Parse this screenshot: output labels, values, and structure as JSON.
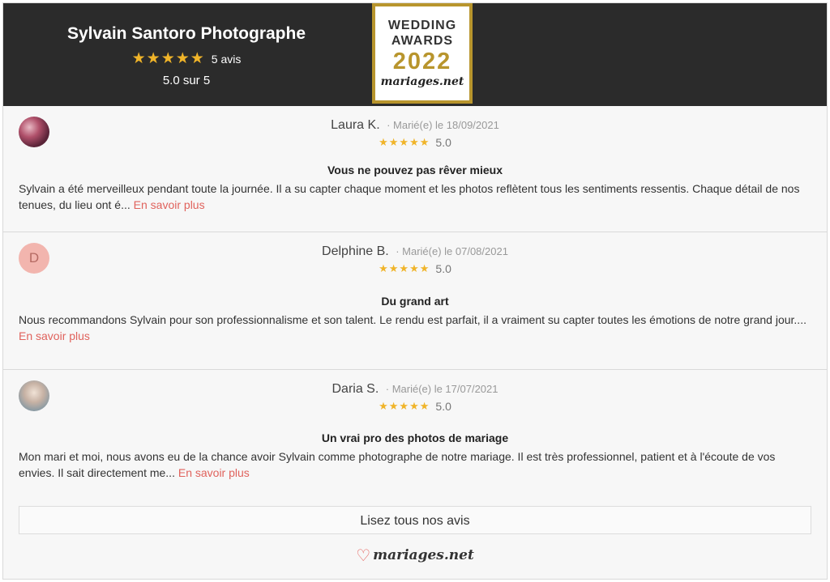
{
  "header": {
    "business_name": "Sylvain Santoro Photographe",
    "stars": "★★★★★",
    "review_count": "5 avis",
    "score": "5.0 sur 5"
  },
  "badge": {
    "line1": "WEDDING",
    "line2": "AWARDS",
    "year": "2022",
    "brand": "mariages.net"
  },
  "reviews": [
    {
      "name": "Laura K.",
      "date": "· Marié(e) le 18/09/2021",
      "stars": "★★★★★",
      "score": "5.0",
      "title": "Vous ne pouvez pas rêver mieux",
      "text": "Sylvain a été merveilleux pendant toute la journée. Il a su capter chaque moment et les photos reflètent tous les sentiments ressentis. Chaque détail de nos tenues, du lieu ont é...",
      "more": "En savoir plus"
    },
    {
      "name": "Delphine B.",
      "initial": "D",
      "date": "· Marié(e) le 07/08/2021",
      "stars": "★★★★★",
      "score": "5.0",
      "title": "Du grand art",
      "text": "Nous recommandons Sylvain pour son professionnalisme et son talent. Le rendu est parfait, il a vraiment su capter toutes les émotions de notre grand jour....",
      "more": "En savoir plus"
    },
    {
      "name": "Daria S.",
      "date": "· Marié(e) le 17/07/2021",
      "stars": "★★★★★",
      "score": "5.0",
      "title": "Un vrai pro des photos de mariage",
      "text": "Mon mari et moi, nous avons eu de la chance avoir Sylvain comme photographe de notre mariage. Il est très professionnel, patient et à l'écoute de vos envies. Il sait directement me...",
      "more": "En savoir plus"
    }
  ],
  "footer": {
    "all_reviews_label": "Lisez tous nos avis",
    "logo_heart": "♡",
    "logo_text": "mariages.net"
  },
  "colors": {
    "header_bg": "#2b2b2b",
    "star": "#f0b429",
    "link": "#e0625c",
    "badge_gold": "#b8952d"
  }
}
